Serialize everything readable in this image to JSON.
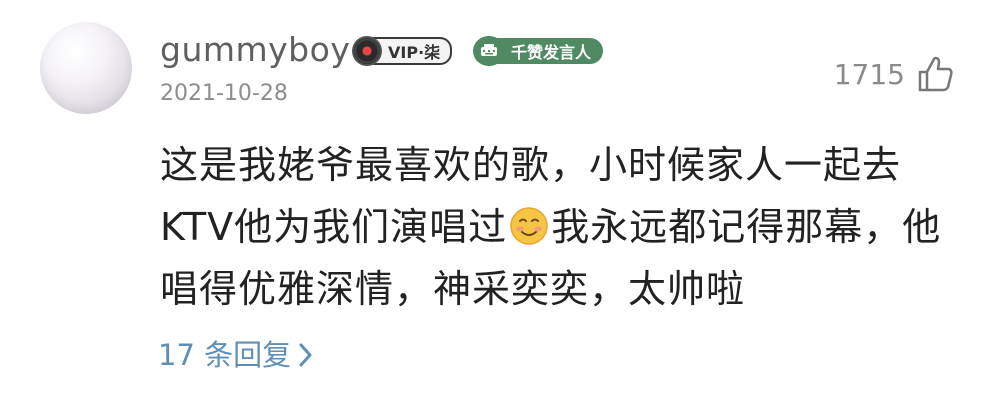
{
  "user": {
    "name": "gummyboy",
    "date": "2021-10-28",
    "badges": [
      {
        "label": "VIP·柒",
        "icon": "vinyl-record-icon"
      },
      {
        "label": "千赞发言人",
        "icon": "typewriter-icon",
        "color": "#4f8a63"
      }
    ]
  },
  "likes": {
    "count": "1715",
    "icon": "thumbs-up-icon"
  },
  "comment": {
    "line1": "这是我姥爷最喜欢的歌，小时候家人一起去",
    "line2_before_emoji": "KTV他为我们演唱过",
    "emoji": "smiling-face-icon",
    "line2_after_emoji": "我永远都记得那幕，他",
    "line3": "唱得优雅深情，神采奕奕，太帅啦"
  },
  "replies": {
    "label": "17 条回复",
    "color": "#5f8fb7"
  }
}
